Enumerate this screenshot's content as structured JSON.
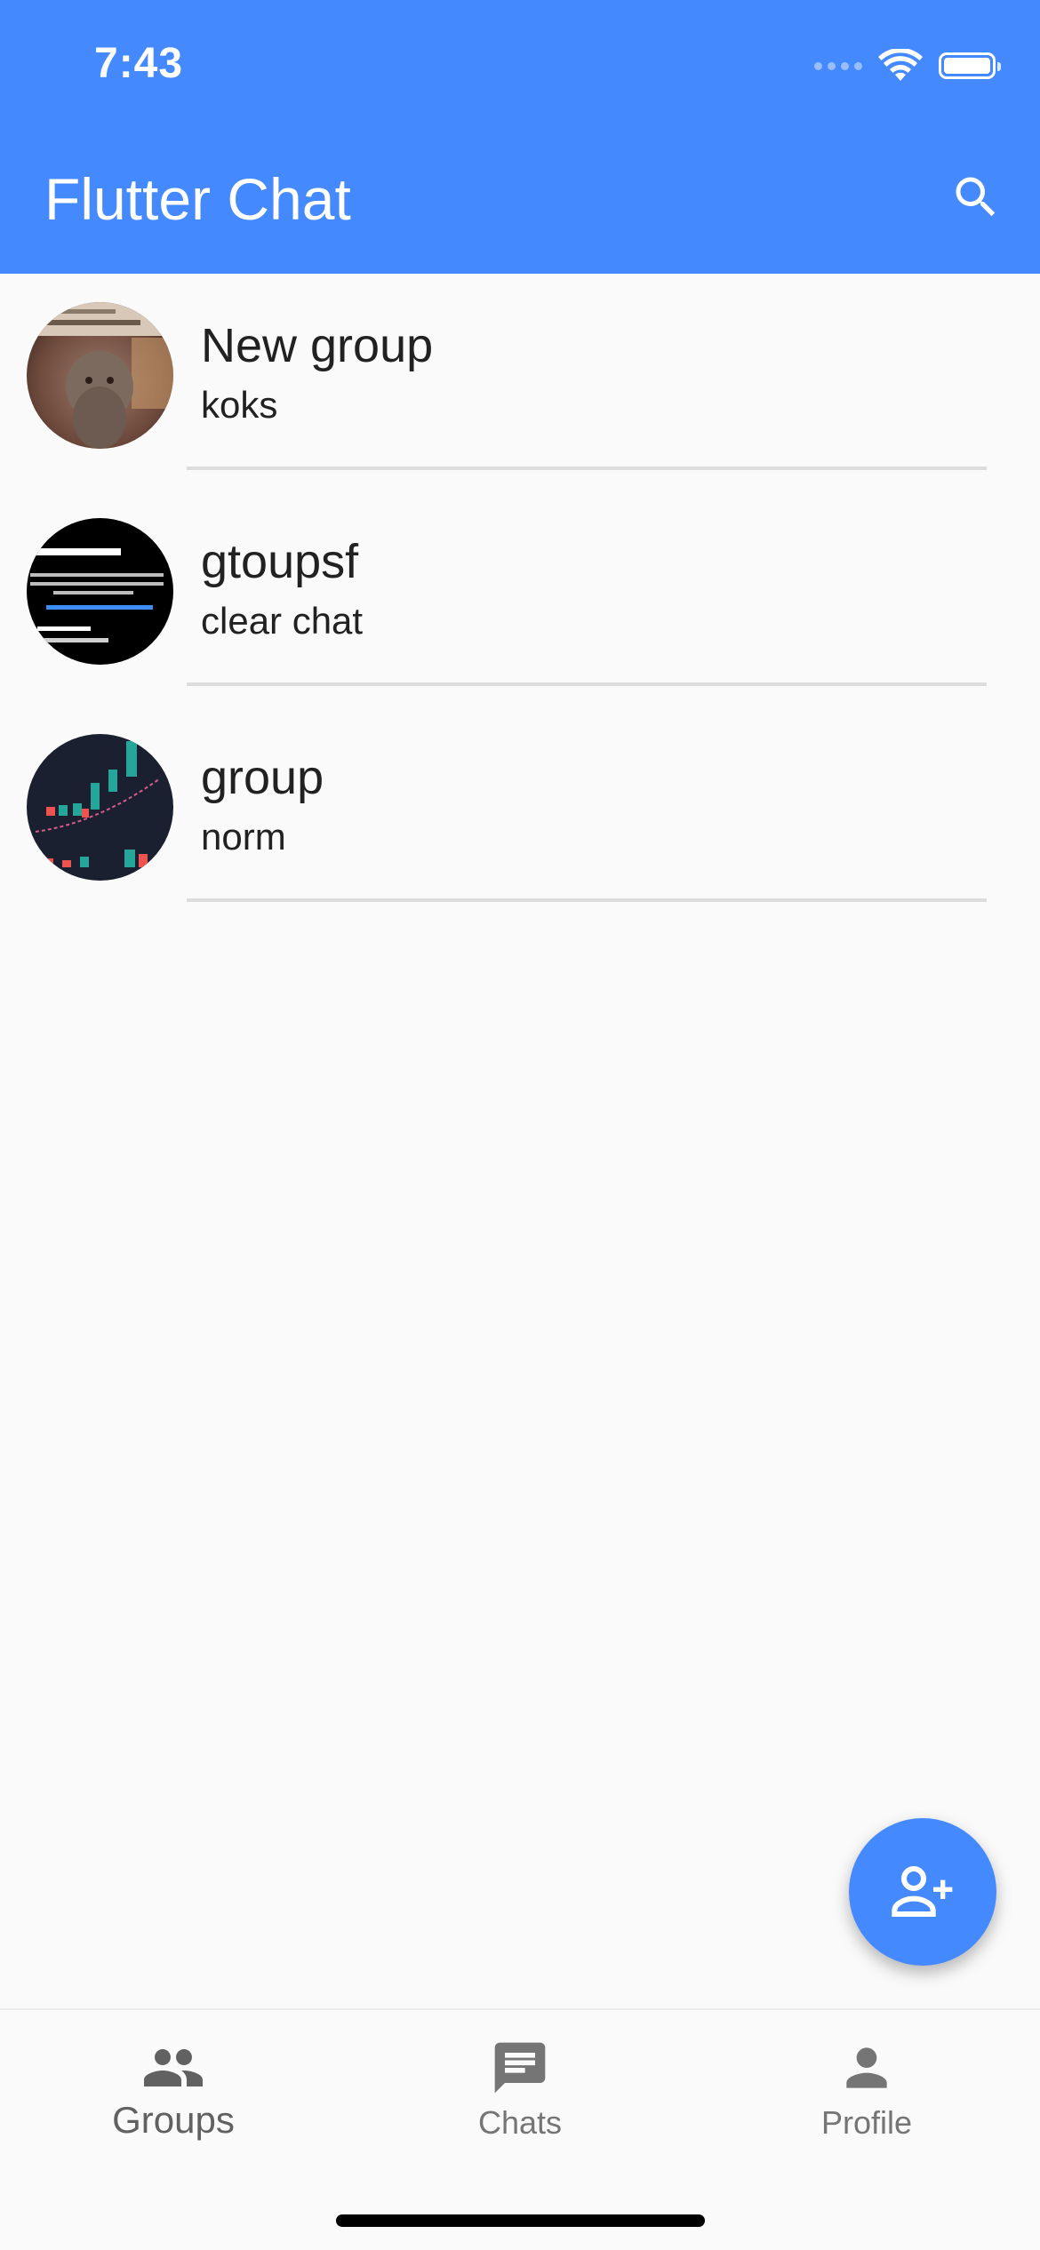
{
  "status_bar": {
    "time": "7:43"
  },
  "app_bar": {
    "title": "Flutter Chat",
    "search_icon": "search-icon"
  },
  "colors": {
    "primary": "#4589ff",
    "background": "#fafafa",
    "text": "#212121",
    "nav_inactive": "#757575",
    "divider": "#dddddd"
  },
  "groups": [
    {
      "name": "New group",
      "last_message": "koks",
      "avatar": "cat-photo"
    },
    {
      "name": "gtoupsf",
      "last_message": "clear chat",
      "avatar": "message-requests-screenshot"
    },
    {
      "name": "group",
      "last_message": "norm",
      "avatar": "trading-chart-screenshot"
    }
  ],
  "fab": {
    "icon": "add-user-icon"
  },
  "bottom_nav": {
    "items": [
      {
        "label": "Groups",
        "icon": "groups-icon",
        "active": true
      },
      {
        "label": "Chats",
        "icon": "chat-icon",
        "active": false
      },
      {
        "label": "Profile",
        "icon": "person-icon",
        "active": false
      }
    ]
  }
}
